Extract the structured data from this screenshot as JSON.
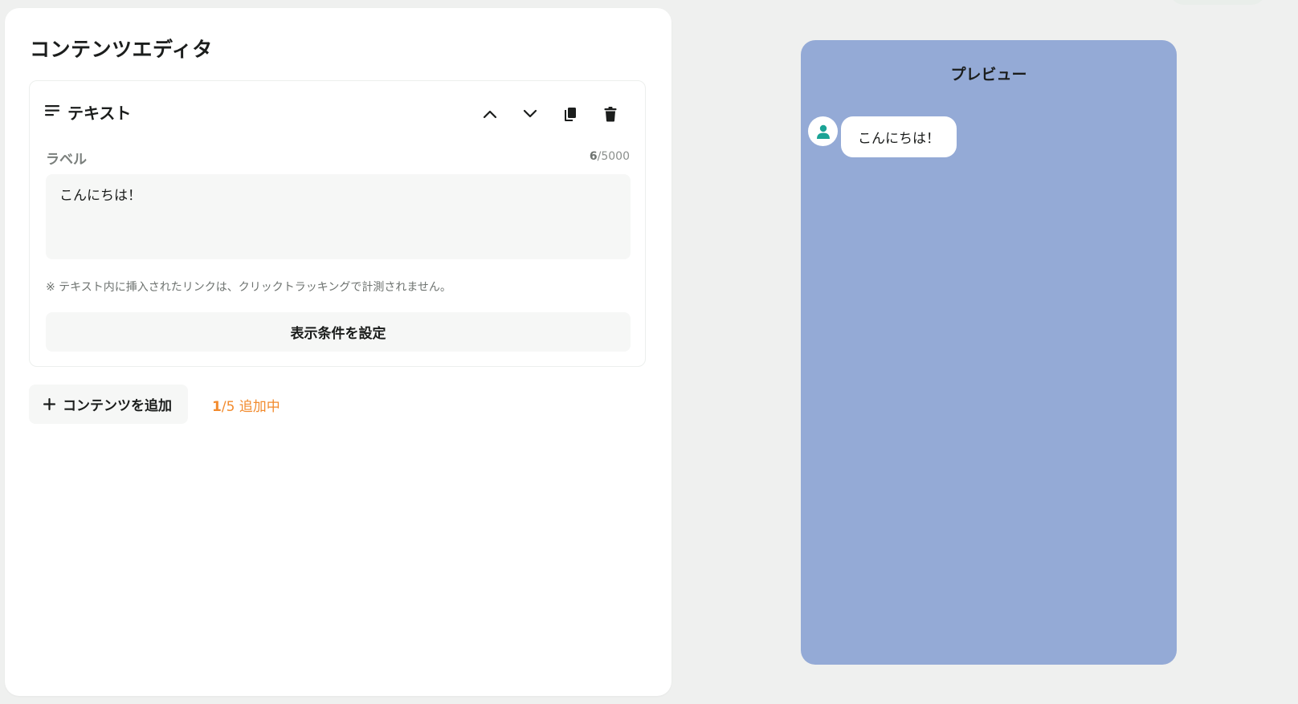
{
  "editor": {
    "title": "コンテンツエディタ",
    "block": {
      "type_label": "テキスト",
      "icon": "text-lines-icon",
      "actions": [
        "chevron-up-icon",
        "chevron-down-icon",
        "copy-icon",
        "trash-icon"
      ],
      "field_label": "ラベル",
      "char_count_current": "6",
      "char_count_max": "/5000",
      "text_value": "こんにちは！",
      "note": "※ テキスト内に挿入されたリンクは、クリックトラッキングで計測されません。",
      "condition_button_label": "表示条件を設定"
    },
    "add_content_label": "コンテンツを追加",
    "count_current": "1",
    "count_rest": "/5 追加中"
  },
  "preview": {
    "title": "プレビュー",
    "messages": [
      {
        "avatar_icon": "user-icon",
        "text": "こんにちは！"
      }
    ]
  },
  "colors": {
    "accent_orange": "#f28b2e",
    "preview_background": "#94aad6",
    "avatar_teal": "#1aa395"
  }
}
